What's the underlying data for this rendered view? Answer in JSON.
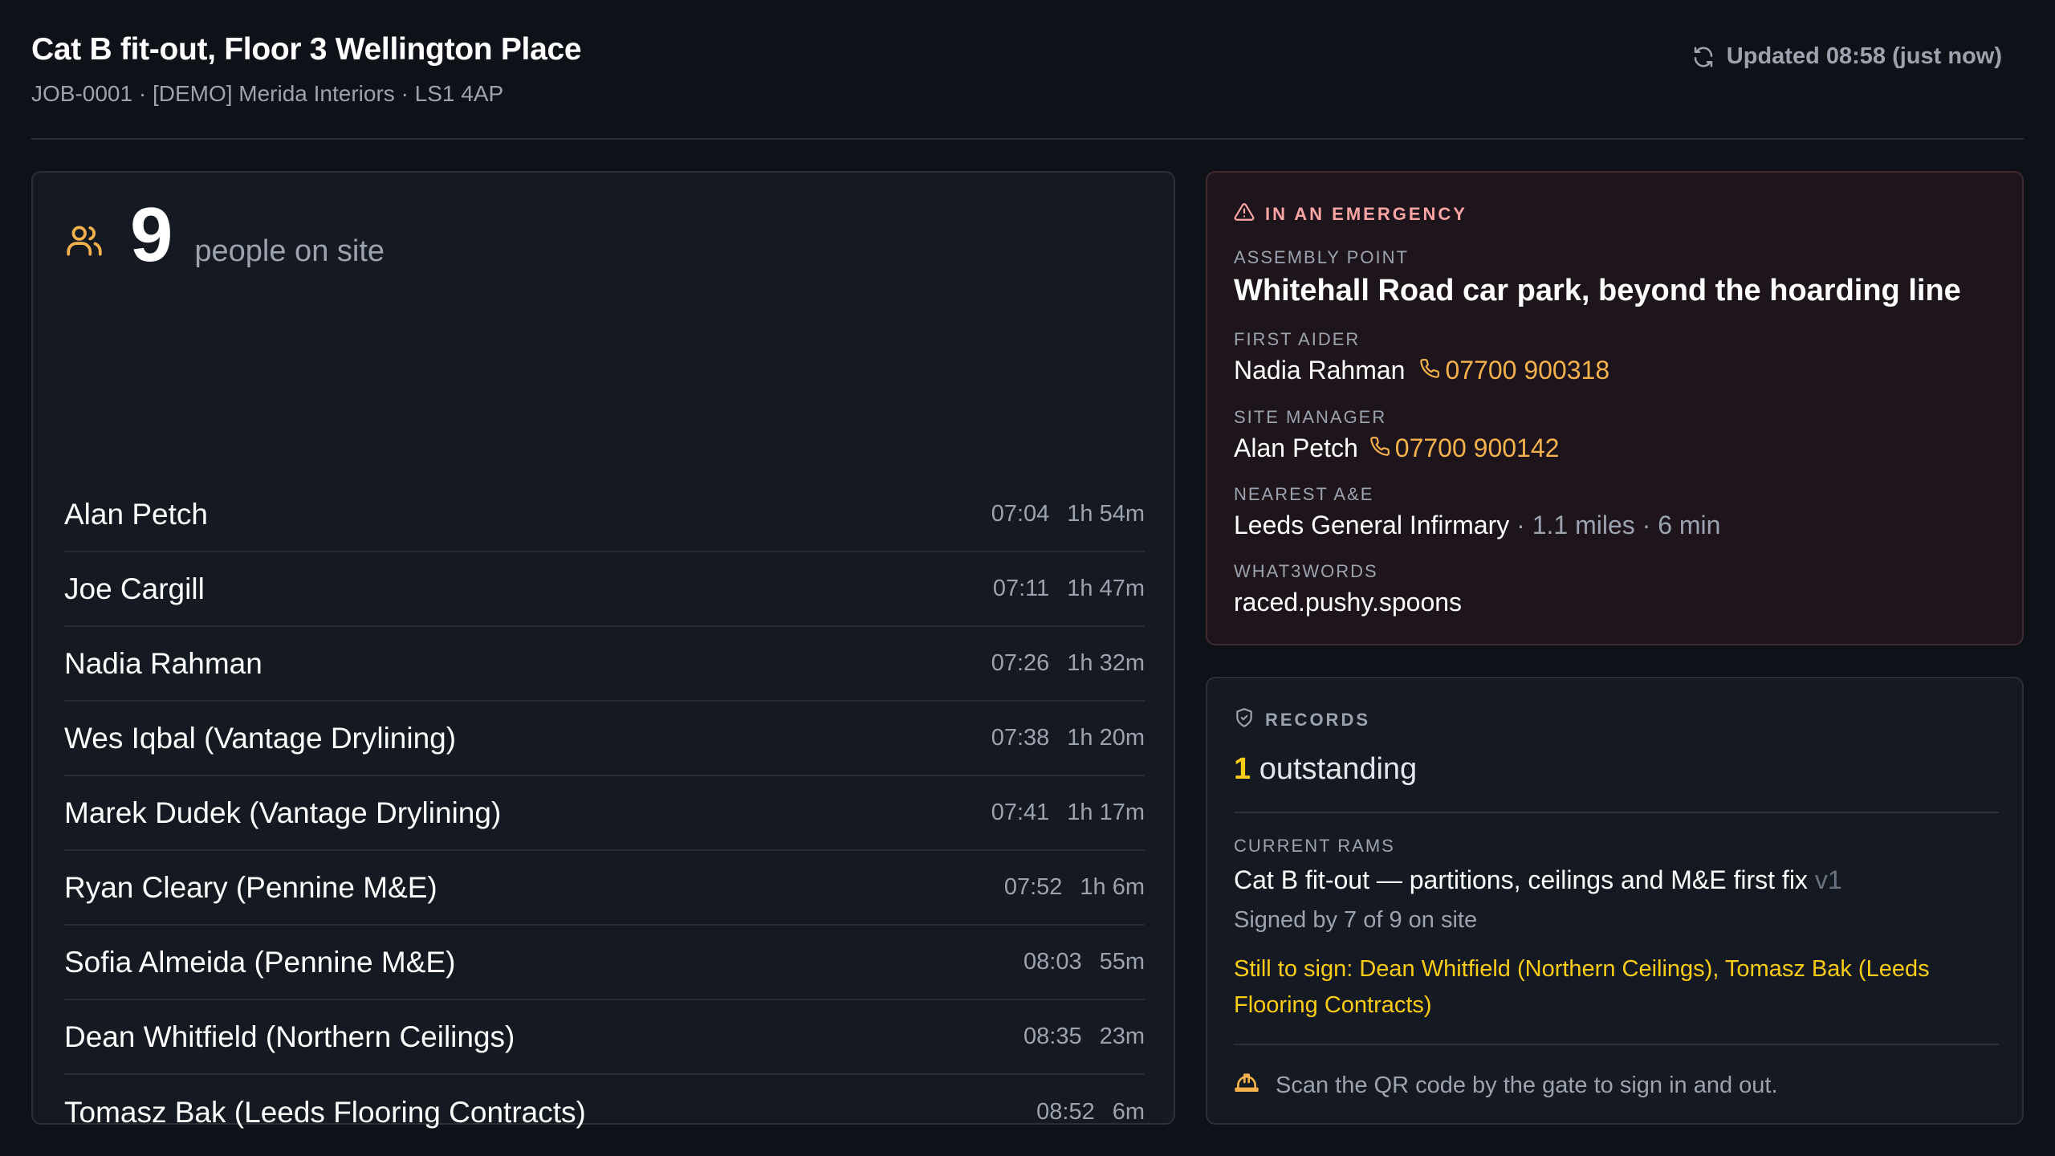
{
  "header": {
    "title": "Cat B fit-out, Floor 3 Wellington Place",
    "subtitle": "JOB-0001 · [DEMO] Merida Interiors · LS1 4AP",
    "updated": "Updated 08:58 (just now)",
    "updated_icon": "refresh-icon"
  },
  "people": {
    "count": "9",
    "count_label": "people on site",
    "icon": "people-icon",
    "rows": [
      {
        "name": "Alan Petch",
        "time_in": "07:04",
        "duration": "1h 54m"
      },
      {
        "name": "Joe Cargill",
        "time_in": "07:11",
        "duration": "1h 47m"
      },
      {
        "name": "Nadia Rahman",
        "time_in": "07:26",
        "duration": "1h 32m"
      },
      {
        "name": "Wes Iqbal (Vantage Drylining)",
        "time_in": "07:38",
        "duration": "1h 20m"
      },
      {
        "name": "Marek Dudek (Vantage Drylining)",
        "time_in": "07:41",
        "duration": "1h 17m"
      },
      {
        "name": "Ryan Cleary (Pennine M&E)",
        "time_in": "07:52",
        "duration": "1h 6m"
      },
      {
        "name": "Sofia Almeida (Pennine M&E)",
        "time_in": "08:03",
        "duration": "55m"
      },
      {
        "name": "Dean Whitfield (Northern Ceilings)",
        "time_in": "08:35",
        "duration": "23m"
      },
      {
        "name": "Tomasz Bak (Leeds Flooring Contracts)",
        "time_in": "08:52",
        "duration": "6m"
      }
    ]
  },
  "emergency": {
    "heading": "IN AN EMERGENCY",
    "icon": "warning-triangle-icon",
    "assembly_label": "ASSEMBLY POINT",
    "assembly_value": "Whitehall Road car park, beyond the hoarding line",
    "first_aider_label": "FIRST AIDER",
    "first_aider_name": "Nadia Rahman",
    "first_aider_phone": "07700 900318",
    "site_manager_label": "SITE MANAGER",
    "site_manager_name": "Alan Petch",
    "site_manager_phone": "07700 900142",
    "ae_label": "NEAREST A&E",
    "ae_name": "Leeds General Infirmary",
    "ae_details": " · 1.1 miles · 6 min",
    "w3w_label": "WHAT3WORDS",
    "w3w_value": "raced.pushy.spoons",
    "phone_icon": "phone-icon"
  },
  "records": {
    "heading": "RECORDS",
    "icon": "shield-check-icon",
    "outstanding_count": "1",
    "outstanding_label": " outstanding",
    "rams_label": "CURRENT RAMS",
    "rams_title": "Cat B fit-out — partitions, ceilings and M&E first fix",
    "rams_version": " v1",
    "signed_by": "Signed by 7 of 9 on site",
    "still_to_sign": "Still to sign: Dean Whitfield (Northern Ceilings), Tomasz Bak (Leeds Flooring Contracts)",
    "qr_note": "Scan the QR code by the gate to sign in and out.",
    "qr_icon": "hard-hat-icon"
  },
  "colors": {
    "background": "#0e1218",
    "card": "#141922",
    "emergency_card": "#1d151b",
    "accent_orange": "#f5b14c",
    "accent_yellow": "#facc15",
    "emergency_heading": "#fca5a5"
  }
}
